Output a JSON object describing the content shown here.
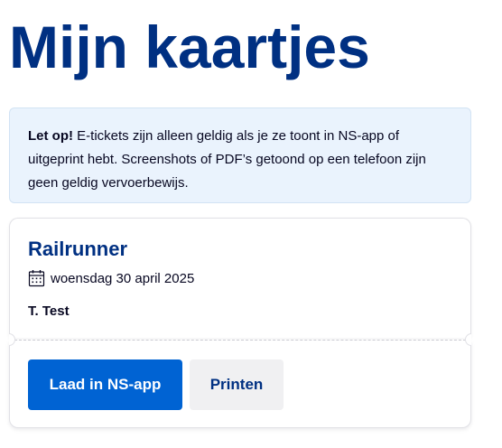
{
  "page": {
    "title": "Mijn kaartjes"
  },
  "notice": {
    "strong": "Let op!",
    "text": " E-tickets zijn alleen geldig als je ze toont in NS-app of uitgeprint hebt. Screenshots of PDF’s getoond op een telefoon zijn geen geldig vervoerbewijs."
  },
  "ticket": {
    "title": "Railrunner",
    "date_icon": "calendar-icon",
    "date": "woensdag 30 april 2025",
    "traveler": "T. Test",
    "load_button": "Laad in NS-app",
    "print_button": "Printen"
  },
  "colors": {
    "brand_blue": "#003082",
    "primary_button": "#0063d3",
    "notice_background": "#eaf3fd"
  }
}
